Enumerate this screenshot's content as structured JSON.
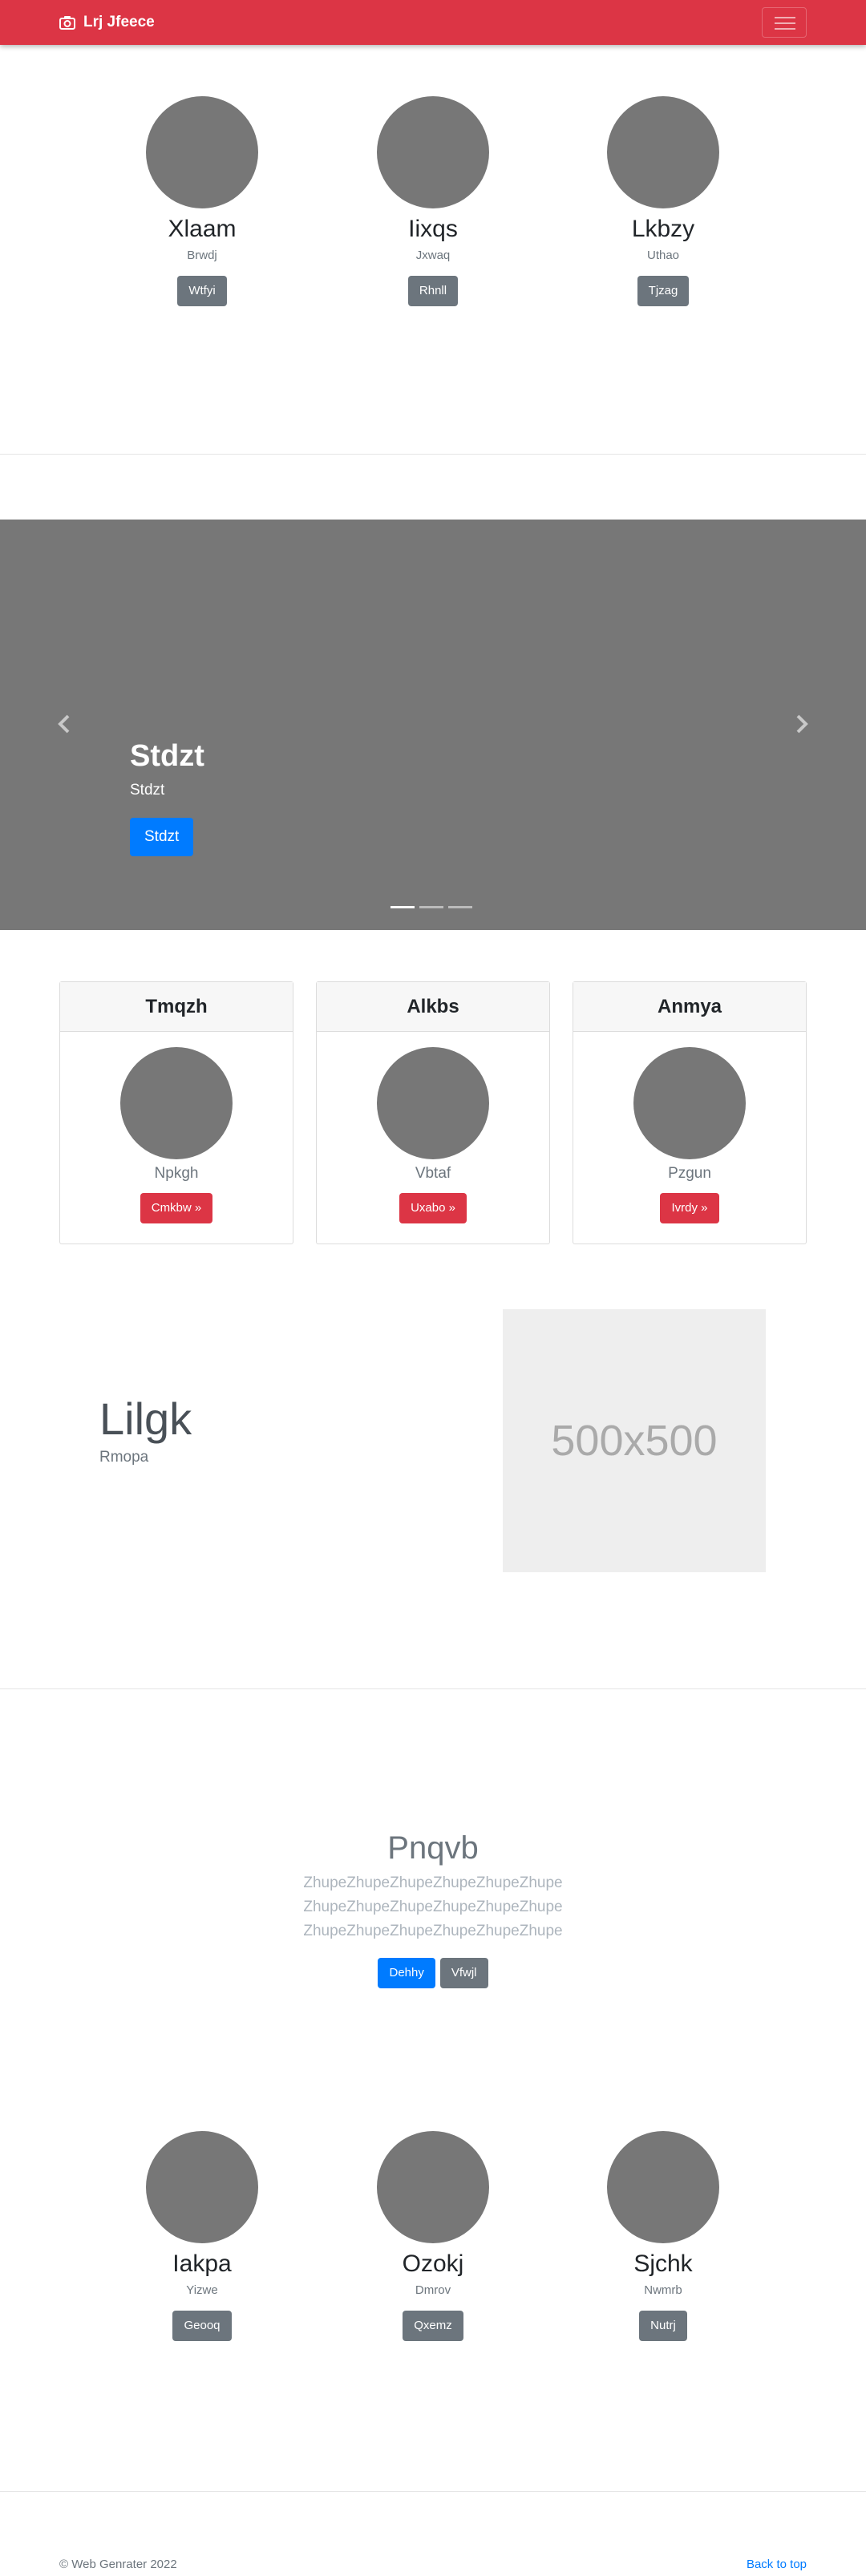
{
  "navbar": {
    "brand": "Lrj Jfeece",
    "brand_icon": "camera-icon",
    "toggler_icon": "hamburger-menu-icon",
    "color": "#dc3545"
  },
  "people_top": [
    {
      "name": "Xlaam",
      "sub": "Brwdj",
      "button": "Wtfyi"
    },
    {
      "name": "Iixqs",
      "sub": "Jxwaq",
      "button": "Rhnll"
    },
    {
      "name": "Lkbzy",
      "sub": "Uthao",
      "button": "Tjzag"
    }
  ],
  "carousel": {
    "heading": "Stdzt",
    "text": "Stdzt",
    "button": "Stdzt",
    "prev_icon": "chevron-left-icon",
    "next_icon": "chevron-right-icon",
    "slides_count": 3,
    "active_slide": 1
  },
  "cards": [
    {
      "title": "Tmqzh",
      "sub": "Npkgh",
      "button": "Cmkbw »"
    },
    {
      "title": "Alkbs",
      "sub": "Vbtaf",
      "button": "Uxabo »"
    },
    {
      "title": "Anmya",
      "sub": "Pzgun",
      "button": "Ivrdy »"
    }
  ],
  "feature": {
    "title": "Lilgk",
    "sub": "Rmopa",
    "image_label": "500x500"
  },
  "jumbotron": {
    "title": "Pnqvb",
    "lines": [
      "ZhupeZhupeZhupeZhupeZhupeZhupe",
      "ZhupeZhupeZhupeZhupeZhupeZhupe",
      "ZhupeZhupeZhupeZhupeZhupeZhupe"
    ],
    "primary_button": "Dehhy",
    "secondary_button": "Vfwjl"
  },
  "people_bottom": [
    {
      "name": "Iakpa",
      "sub": "Yizwe",
      "button": "Geooq"
    },
    {
      "name": "Ozokj",
      "sub": "Dmrov",
      "button": "Qxemz"
    },
    {
      "name": "Sjchk",
      "sub": "Nwmrb",
      "button": "Nutrj"
    }
  ],
  "footer": {
    "copyright": "© Web Genrater 2022",
    "back_to_top": "Back to top"
  }
}
